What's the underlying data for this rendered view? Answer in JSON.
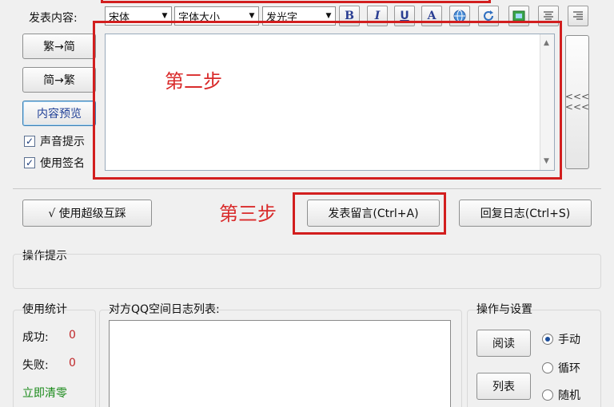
{
  "toolbar": {
    "content_label": "发表内容:",
    "font_select": "宋体",
    "size_select": "字体大小",
    "color_select": "发光字",
    "bold": "B",
    "italic": "I",
    "underline": "U",
    "font_color": "A"
  },
  "left_buttons": {
    "trad_to_simp": "繁→简",
    "simp_to_trad": "简→繁",
    "preview": "内容预览"
  },
  "checks": {
    "sound": "声音提示",
    "signature": "使用签名"
  },
  "collapse_arrows": "<<<\n<<<",
  "annotations": {
    "step2": "第二步",
    "step3": "第三步"
  },
  "actions": {
    "super_interact": "√ 使用超级互踩",
    "post_comment": "发表留言(Ctrl+A)",
    "reply_log": "回复日志(Ctrl+S)"
  },
  "op_hint": {
    "title": "操作提示"
  },
  "stats": {
    "title": "使用统计",
    "success_label": "成功:",
    "success_value": "0",
    "fail_label": "失败:",
    "fail_value": "0",
    "reset": "立即清零"
  },
  "log_list": {
    "title": "对方QQ空间日志列表:"
  },
  "settings": {
    "title": "操作与设置",
    "read_button": "阅读",
    "list_button": "列表",
    "radio_manual": "手动",
    "radio_loop": "循环",
    "radio_random": "随机"
  },
  "colors": {
    "annotation_red": "#d21e1e",
    "value_red": "#c0282a",
    "reset_green": "#1a8a1a"
  }
}
